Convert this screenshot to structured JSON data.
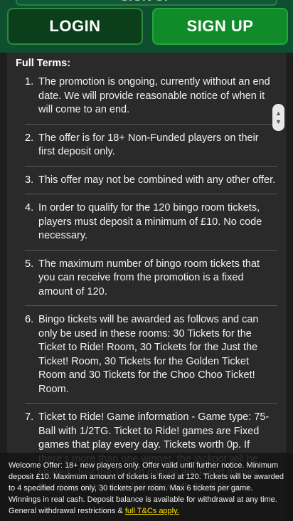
{
  "header": {
    "partial_button": "SIGN UP",
    "login_label": "LOGIN",
    "signup_label": "SIGN UP"
  },
  "terms": {
    "title": "Full Terms:",
    "items": [
      {
        "num": "1.",
        "text": "The promotion is ongoing, currently without an end date. We will provide reasonable notice of when it will come to an end."
      },
      {
        "num": "2.",
        "text": "The offer is for 18+ Non-Funded players on their first deposit only."
      },
      {
        "num": "3.",
        "text": "This offer may not be combined with any other offer."
      },
      {
        "num": "4.",
        "text": "In order to qualify for the 120 bingo room tickets, players must deposit a minimum of £10. No code necessary."
      },
      {
        "num": "5.",
        "text": "The maximum number of bingo room tickets that you can receive from the promotion is a fixed amount of 120."
      },
      {
        "num": "6.",
        "text": "Bingo tickets will be awarded as follows and can only be used in these rooms: 30 Tickets for the Ticket to Ride! Room, 30 Tickets for the Just the Ticket! Room, 30 Tickets for the Golden Ticket Room and 30 Tickets for the Choo Choo Ticket! Room."
      },
      {
        "num": "7.",
        "text": "Ticket to Ride! Game information - Game type: 75-Ball with 1/2TG. Ticket to Ride! games are Fixed games that play every day. Tickets worth 0p. If there's more than one winner, the jackpot will be shared. Just the Ticket! games are Fixed games that play every day. Tickets worth 0p. If there's"
      }
    ]
  },
  "footer": {
    "text": "Welcome Offer: 18+ new players only. Offer valid until further notice. Minimum deposit £10. Maximum amount of tickets is fixed at 120. Tickets will be awarded to 4 specified rooms only, 30 tickets per room. Max 6 tickets per game. Winnings in real cash. Deposit balance is available for withdrawal at any time. General withdrawal restrictions & ",
    "link_label": "full T&Cs apply."
  },
  "icons": {
    "scroll_up": "chevron-up-icon",
    "scroll_down": "chevron-down-icon"
  }
}
